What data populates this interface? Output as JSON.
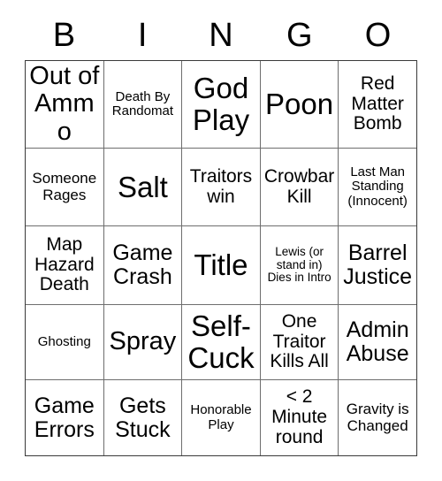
{
  "header": {
    "letters": [
      "B",
      "I",
      "N",
      "G",
      "O"
    ]
  },
  "grid": {
    "rows": [
      [
        {
          "text": "Out of Ammo",
          "size": "fs-xl"
        },
        {
          "text": "Death By Randomat",
          "size": "fs-xs"
        },
        {
          "text": "God Play",
          "size": "fs-xxl"
        },
        {
          "text": "Poon",
          "size": "fs-xxl"
        },
        {
          "text": "Red Matter Bomb",
          "size": "fs-md"
        }
      ],
      [
        {
          "text": "Someone Rages",
          "size": "fs-sm"
        },
        {
          "text": "Salt",
          "size": "fs-xxl"
        },
        {
          "text": "Traitors win",
          "size": "fs-md"
        },
        {
          "text": "Crowbar Kill",
          "size": "fs-md"
        },
        {
          "text": "Last Man Standing (Innocent)",
          "size": "fs-xs"
        }
      ],
      [
        {
          "text": "Map Hazard Death",
          "size": "fs-md"
        },
        {
          "text": "Game Crash",
          "size": "fs-lg"
        },
        {
          "text": "Title",
          "size": "fs-xxl"
        },
        {
          "text": "Lewis (or stand in) Dies in Intro",
          "size": "fs-xxs"
        },
        {
          "text": "Barrel Justice",
          "size": "fs-lg"
        }
      ],
      [
        {
          "text": "Ghosting",
          "size": "fs-xs"
        },
        {
          "text": "Spray",
          "size": "fs-xl"
        },
        {
          "text": "Self-Cuck",
          "size": "fs-xxl"
        },
        {
          "text": "One Traitor Kills All",
          "size": "fs-md"
        },
        {
          "text": "Admin Abuse",
          "size": "fs-lg"
        }
      ],
      [
        {
          "text": "Game Errors",
          "size": "fs-lg"
        },
        {
          "text": "Gets Stuck",
          "size": "fs-lg"
        },
        {
          "text": "Honorable Play",
          "size": "fs-xs"
        },
        {
          "text": "< 2 Minute round",
          "size": "fs-md"
        },
        {
          "text": "Gravity is Changed",
          "size": "fs-sm"
        }
      ]
    ]
  },
  "colors": {
    "background": "#ffffff",
    "text": "#000000",
    "grid_outer_border": "#3a3a3a",
    "grid_inner_border": "#6e6e6e"
  }
}
